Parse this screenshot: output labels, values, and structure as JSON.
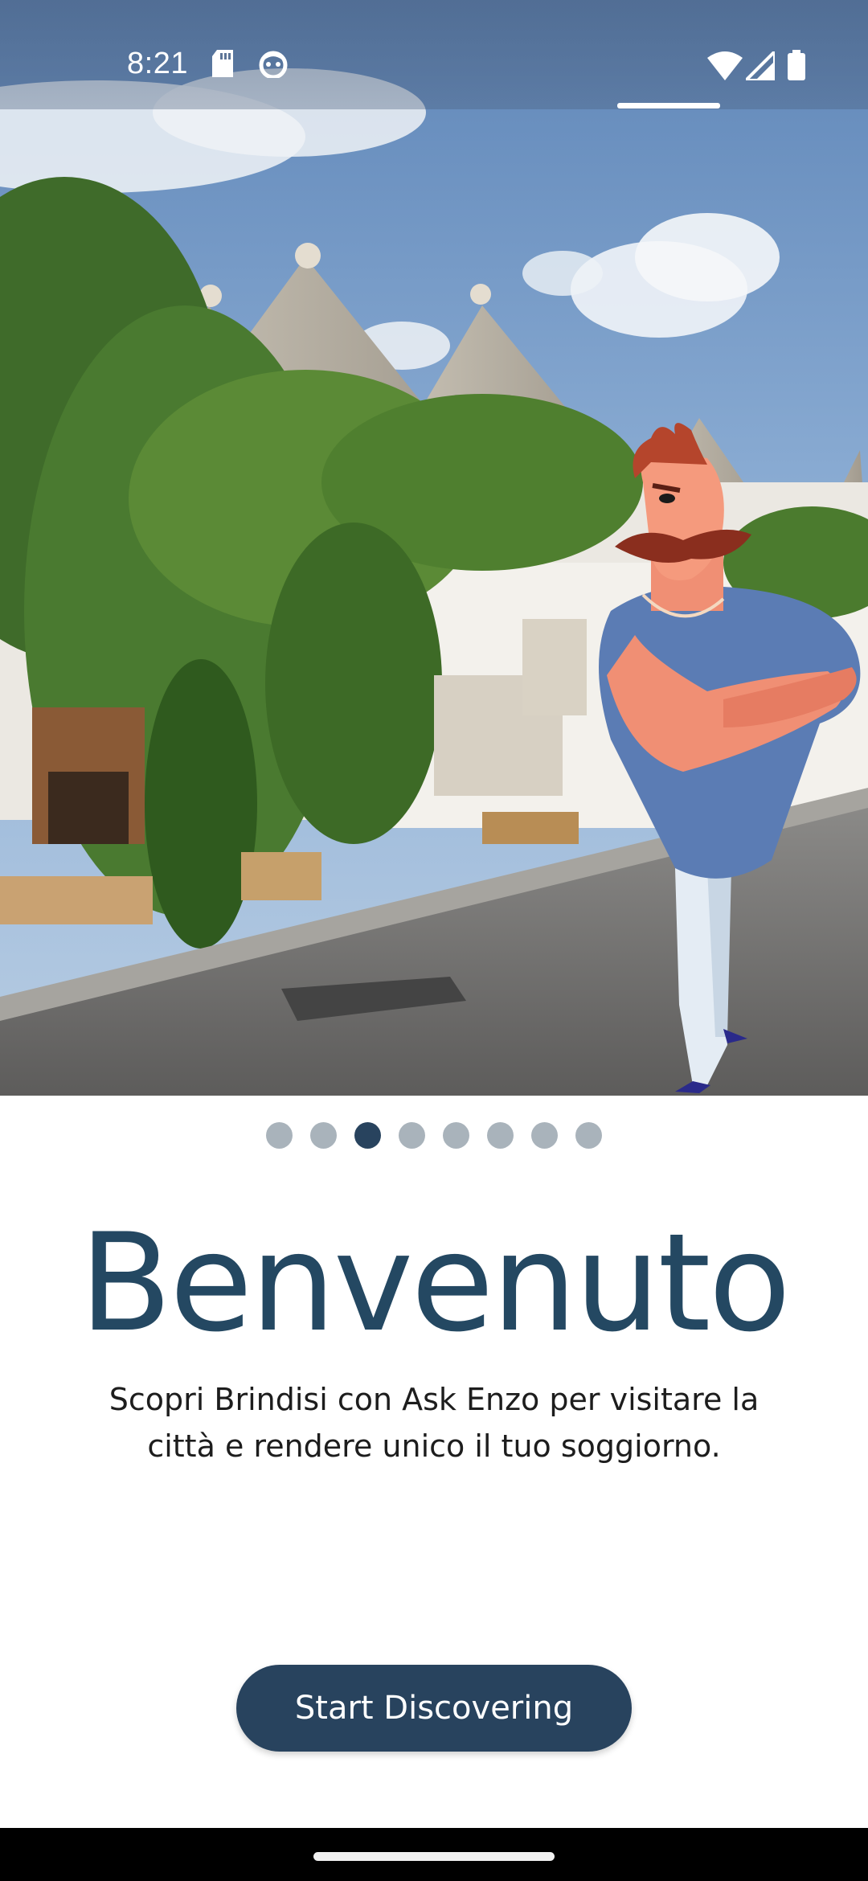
{
  "status_bar": {
    "time": "8:21",
    "icons": [
      "sd-card-icon",
      "face-icon",
      "wifi-icon",
      "signal-icon",
      "battery-icon"
    ]
  },
  "hero": {
    "image": "trulli-street-with-mascot-illustration"
  },
  "pager": {
    "total": 8,
    "active_index": 2
  },
  "content": {
    "title": "Benvenuto",
    "subtitle_line1": "Scopri Brindisi con Ask Enzo per visitare la",
    "subtitle_line2": "città e rendere unico il tuo soggiorno."
  },
  "actions": {
    "start_label": "Start Discovering"
  },
  "colors": {
    "primary": "#28435e",
    "title": "#244862",
    "dot_inactive": "#a9b3bb"
  }
}
